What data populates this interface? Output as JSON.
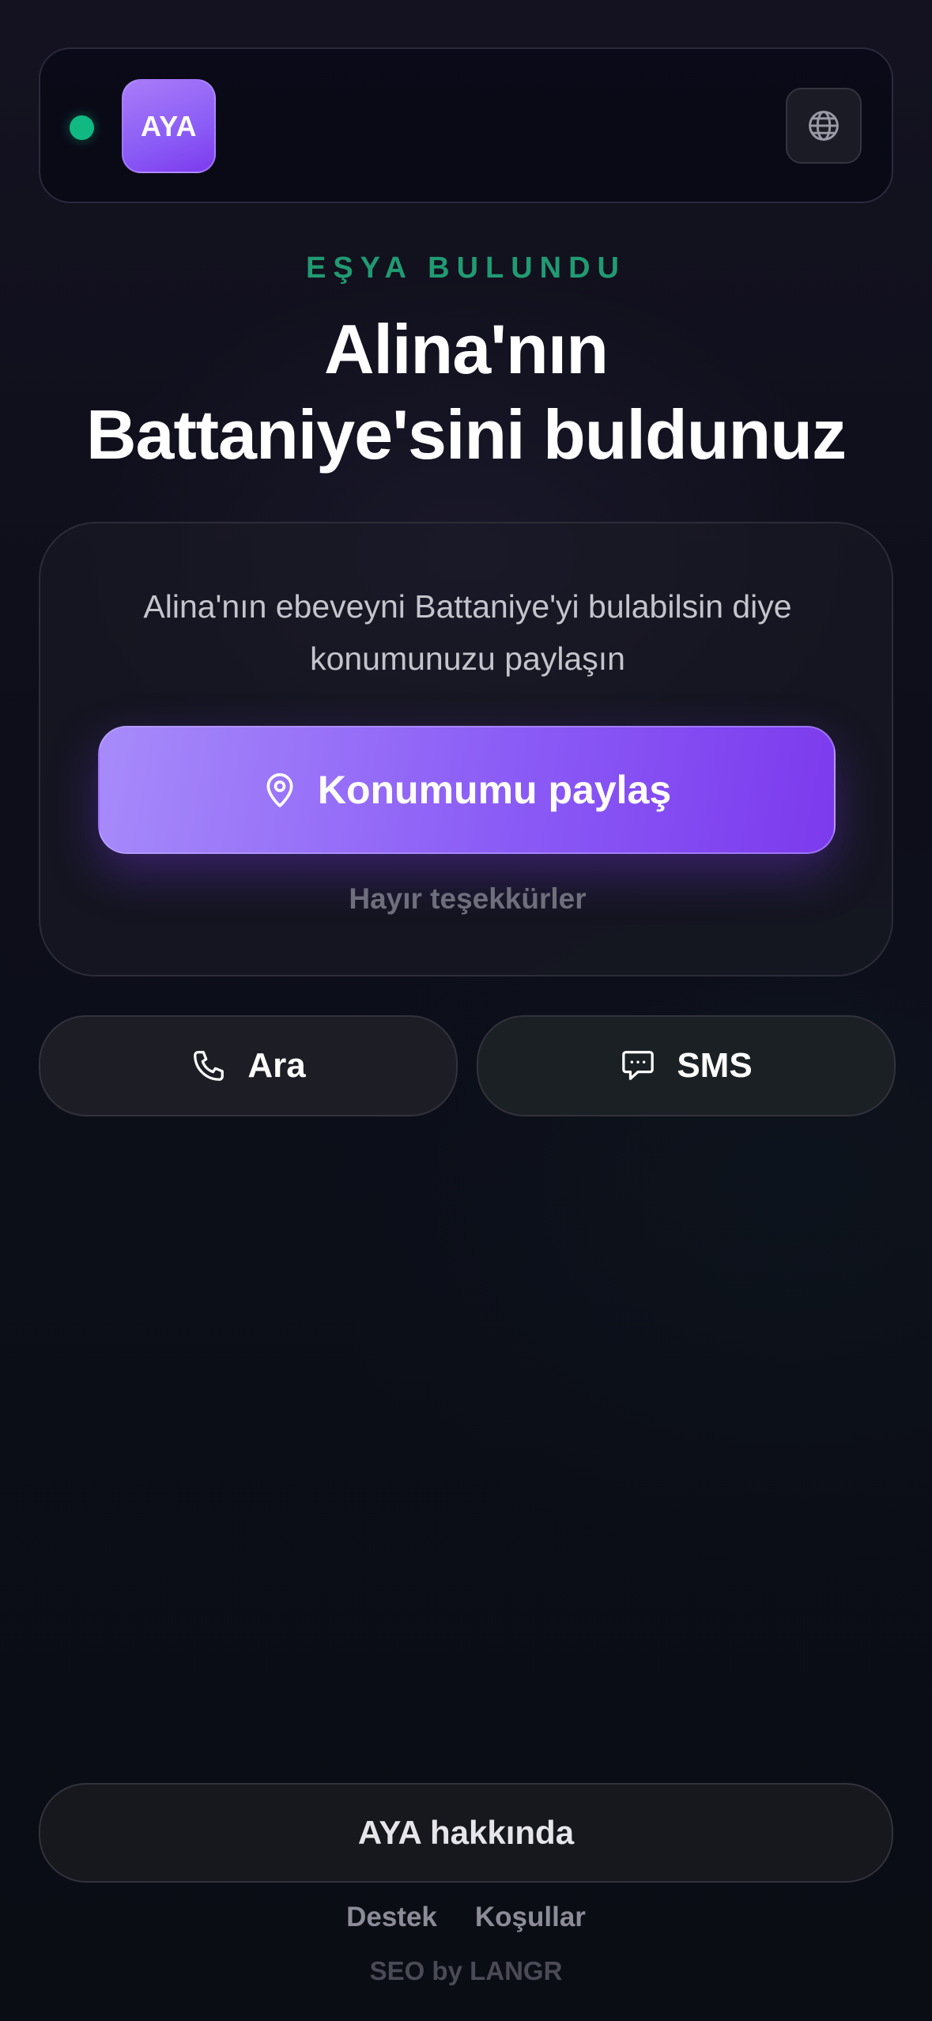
{
  "header": {
    "logo_text": "AYA",
    "status_color": "#10b981",
    "language_icon": "globe-icon"
  },
  "hero": {
    "eyebrow": "EŞYA BULUNDU",
    "title_line1": "Alina'nın",
    "title_line2": "Battaniye'sini buldunuz"
  },
  "card": {
    "description": "Alina'nın ebeveyni Battaniye'yi bulabilsin diye konumunuzu paylaşın",
    "share_button_label": "Konumumu paylaş",
    "share_button_icon": "location-pin-icon",
    "decline_label": "Hayır teşekkürler"
  },
  "contact": {
    "call_label": "Ara",
    "call_icon": "phone-icon",
    "sms_label": "SMS",
    "sms_icon": "message-icon"
  },
  "footer": {
    "about_label": "AYA hakkında",
    "links": [
      "Destek",
      "Koşullar"
    ],
    "credit": "SEO by LANGR"
  },
  "colors": {
    "accent": "#8b5cf6",
    "eyebrow": "#219a72",
    "background": "#0c0d17"
  }
}
